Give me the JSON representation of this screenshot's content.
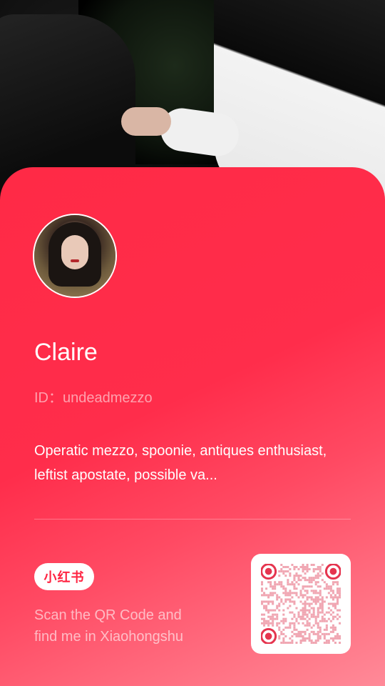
{
  "profile": {
    "name": "Claire",
    "id_text": "ID：undeadmezzo",
    "bio": "Operatic mezzo, spoonie, antiques enthusiast, leftist apostate, possible va..."
  },
  "footer": {
    "logo_text": "小红书",
    "scan_line1": "Scan the QR Code and",
    "scan_line2": "find me in Xiaohongshu"
  },
  "colors": {
    "card_top": "#ff2a46",
    "card_bottom": "#ff8a98",
    "brand_red": "#ff2442"
  }
}
